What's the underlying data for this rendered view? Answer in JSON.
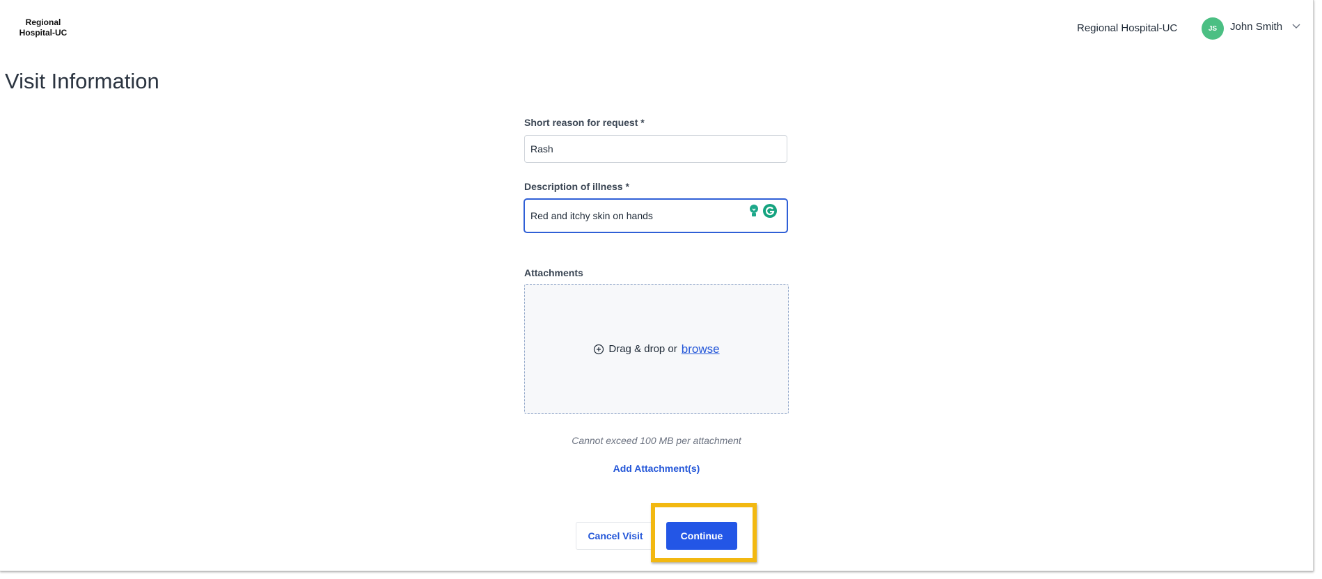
{
  "header": {
    "logo_line1": "Regional",
    "logo_line2": "Hospital-UC",
    "org_name": "Regional Hospital-UC",
    "user_initials": "JS",
    "user_name": "John Smith"
  },
  "page": {
    "title": "Visit Information"
  },
  "form": {
    "reason": {
      "label": "Short reason for request *",
      "value": "Rash"
    },
    "description": {
      "label": "Description of illness *",
      "value": "Red and itchy skin on hands"
    },
    "attachments": {
      "label": "Attachments",
      "drop_text": "Drag & drop or",
      "browse_label": "browse",
      "limit_note": "Cannot exceed 100 MB per attachment",
      "add_label": "Add Attachment(s)"
    }
  },
  "actions": {
    "cancel_label": "Cancel Visit",
    "continue_label": "Continue"
  },
  "colors": {
    "accent": "#2356e6",
    "avatar": "#4bbf83",
    "highlight": "#f2b811"
  },
  "icons": [
    "chevron-down-icon",
    "plus-circle-icon",
    "grammarly-bulb-icon",
    "grammarly-g-icon"
  ]
}
